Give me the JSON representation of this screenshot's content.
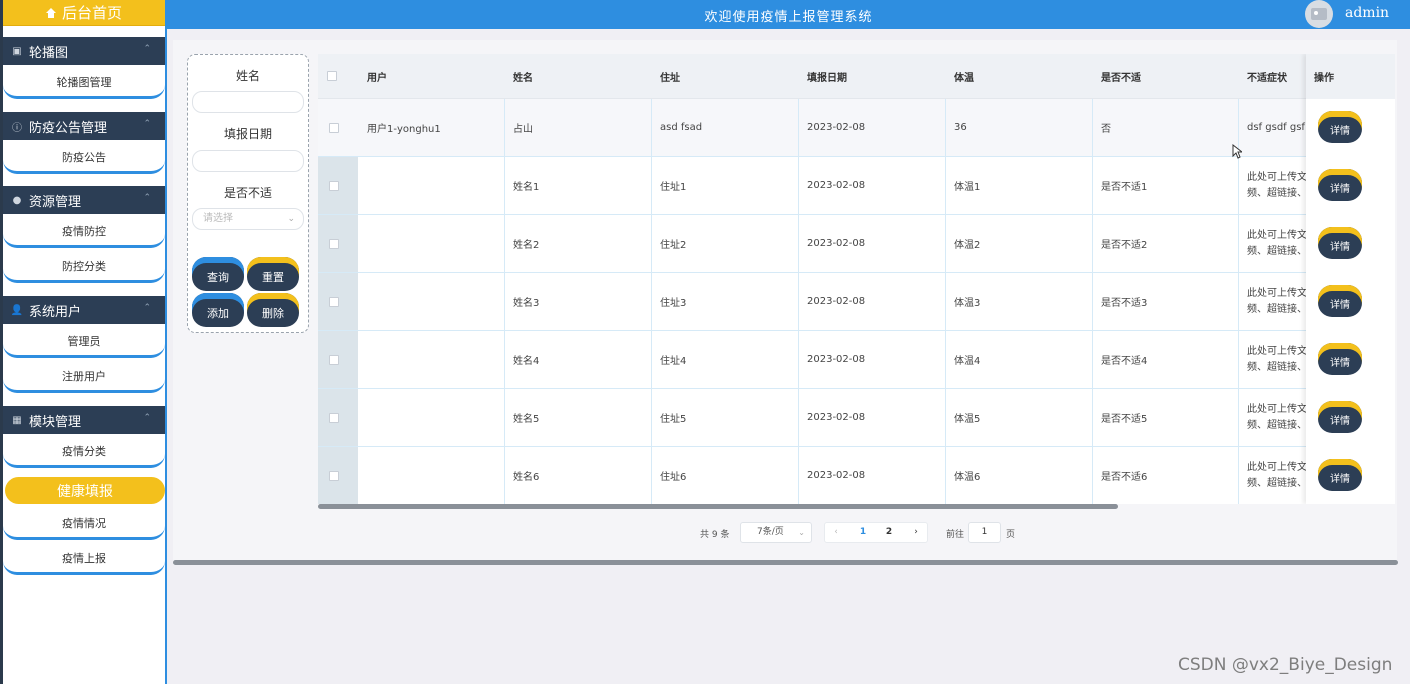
{
  "sidebar": {
    "home_label": "后台首页",
    "groups": [
      {
        "label": "轮播图",
        "items": [
          "轮播图管理"
        ]
      },
      {
        "label": "防疫公告管理",
        "items": [
          "防疫公告"
        ]
      },
      {
        "label": "资源管理",
        "items": [
          "疫情防控",
          "防控分类"
        ]
      },
      {
        "label": "系统用户",
        "items": [
          "管理员",
          "注册用户"
        ]
      },
      {
        "label": "模块管理",
        "items": [
          "疫情分类"
        ]
      }
    ],
    "active_item": "健康填报",
    "extra_items": [
      "疫情情况",
      "疫情上报"
    ]
  },
  "header": {
    "title": "欢迎使用疫情上报管理系统",
    "username": "admin"
  },
  "search": {
    "name_label": "姓名",
    "date_label": "填报日期",
    "unwell_label": "是否不适",
    "select_placeholder": "请选择",
    "query_button": "查询",
    "reset_button": "重置",
    "add_button": "添加",
    "delete_button": "删除"
  },
  "table": {
    "columns": [
      "用户",
      "姓名",
      "住址",
      "填报日期",
      "体温",
      "是否不适",
      "不适症状",
      "操作"
    ],
    "rows": [
      {
        "user": "用户1-yonghu1",
        "name": "占山",
        "address": "asd fsad",
        "date": "2023-02-08",
        "temp": "36",
        "unwell": "否",
        "symptom1": "dsf gsdf gsf",
        "symptom2": ""
      },
      {
        "user": "",
        "name": "姓名1",
        "address": "住址1",
        "date": "2023-02-08",
        "temp": "体温1",
        "unwell": "是否不适1",
        "symptom1": "此处可上传文",
        "symptom2": "频、超链接、"
      },
      {
        "user": "",
        "name": "姓名2",
        "address": "住址2",
        "date": "2023-02-08",
        "temp": "体温2",
        "unwell": "是否不适2",
        "symptom1": "此处可上传文",
        "symptom2": "频、超链接、"
      },
      {
        "user": "",
        "name": "姓名3",
        "address": "住址3",
        "date": "2023-02-08",
        "temp": "体温3",
        "unwell": "是否不适3",
        "symptom1": "此处可上传文",
        "symptom2": "频、超链接、"
      },
      {
        "user": "",
        "name": "姓名4",
        "address": "住址4",
        "date": "2023-02-08",
        "temp": "体温4",
        "unwell": "是否不适4",
        "symptom1": "此处可上传文",
        "symptom2": "频、超链接、"
      },
      {
        "user": "",
        "name": "姓名5",
        "address": "住址5",
        "date": "2023-02-08",
        "temp": "体温5",
        "unwell": "是否不适5",
        "symptom1": "此处可上传文",
        "symptom2": "频、超链接、"
      },
      {
        "user": "",
        "name": "姓名6",
        "address": "住址6",
        "date": "2023-02-08",
        "temp": "体温6",
        "unwell": "是否不适6",
        "symptom1": "此处可上传文",
        "symptom2": "频、超链接、"
      }
    ],
    "detail_button": "详情"
  },
  "pagination": {
    "total": "共 9 条",
    "page_size": "7条/页",
    "pages": [
      "1",
      "2"
    ],
    "current_page": "1",
    "goto_label": "前往",
    "goto_value": "1",
    "page_unit": "页"
  },
  "watermark": "CSDN @vx2_Biye_Design",
  "colors": {
    "primary": "#2e8ee0",
    "accent": "#f3c01c",
    "dark": "#2c3e55"
  }
}
